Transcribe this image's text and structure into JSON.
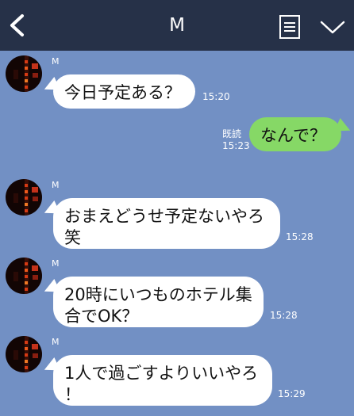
{
  "header": {
    "title": "M",
    "back_icon": "chevron-left-icon",
    "note_icon": "note-list-icon",
    "menu_icon": "chevron-down-icon"
  },
  "colors": {
    "header_bg": "#263148",
    "chat_bg": "#7290c4",
    "incoming_bubble": "#ffffff",
    "outgoing_bubble": "#86d866"
  },
  "messages": [
    {
      "direction": "incoming",
      "sender": "M",
      "lines": [
        "今日予定ある？"
      ],
      "time": "15:20"
    },
    {
      "direction": "outgoing",
      "lines": [
        "なんで？"
      ],
      "read": "既読",
      "time": "15:23"
    },
    {
      "direction": "incoming",
      "sender": "M",
      "lines": [
        "おまえどうせ予定ないやろ",
        "笑"
      ],
      "time": "15:28"
    },
    {
      "direction": "incoming",
      "sender": "M",
      "lines": [
        "20時にいつものホテル集",
        "合でOK？"
      ],
      "time": "15:28"
    },
    {
      "direction": "incoming",
      "sender": "M",
      "lines": [
        "1人で過ごすよりいいやろ",
        "！"
      ],
      "time": "15:29"
    }
  ]
}
